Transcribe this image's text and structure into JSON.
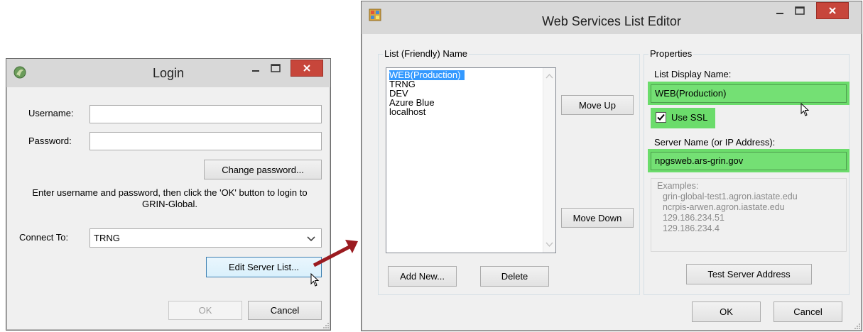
{
  "login": {
    "title": "Login",
    "username_label": "Username:",
    "username_value": "",
    "password_label": "Password:",
    "password_value": "",
    "change_password_label": "Change password...",
    "instructions": "Enter username and password, then click the 'OK' button to login to GRIN-Global.",
    "connect_label": "Connect To:",
    "connect_value": "TRNG",
    "edit_server_list_label": "Edit Server List...",
    "ok_label": "OK",
    "cancel_label": "Cancel"
  },
  "editor": {
    "title": "Web Services List Editor",
    "list_group_title": "List (Friendly) Name",
    "list_items": [
      "WEB(Production)",
      "TRNG",
      "DEV",
      "Azure Blue",
      "localhost"
    ],
    "selected_index": 0,
    "move_up_label": "Move Up",
    "move_down_label": "Move Down",
    "add_new_label": "Add New...",
    "delete_label": "Delete",
    "properties_group_title": "Properties",
    "display_name_label": "List Display Name:",
    "display_name_value": "WEB(Production)",
    "use_ssl_label": "Use SSL",
    "use_ssl_checked": true,
    "server_name_label": "Server Name (or IP Address):",
    "server_name_value": "npgsweb.ars-grin.gov",
    "examples_title": "Examples:",
    "examples": [
      "grin-global-test1.agron.iastate.edu",
      "ncrpis-arwen.agron.iastate.edu",
      "129.186.234.51",
      "129.186.234.4"
    ],
    "test_server_label": "Test Server Address",
    "ok_label": "OK",
    "cancel_label": "Cancel"
  },
  "colors": {
    "highlight_green": "#6bdc6b",
    "selection_blue": "#3399ff",
    "close_red": "#c7463b",
    "arrow_red": "#9b1b20"
  },
  "icons": [
    "login-app-icon",
    "editor-app-icon",
    "minimize-icon",
    "maximize-icon",
    "close-icon",
    "chevron-down-icon",
    "mouse-cursor-icon",
    "red-arrow-icon",
    "resize-grip-icon"
  ]
}
